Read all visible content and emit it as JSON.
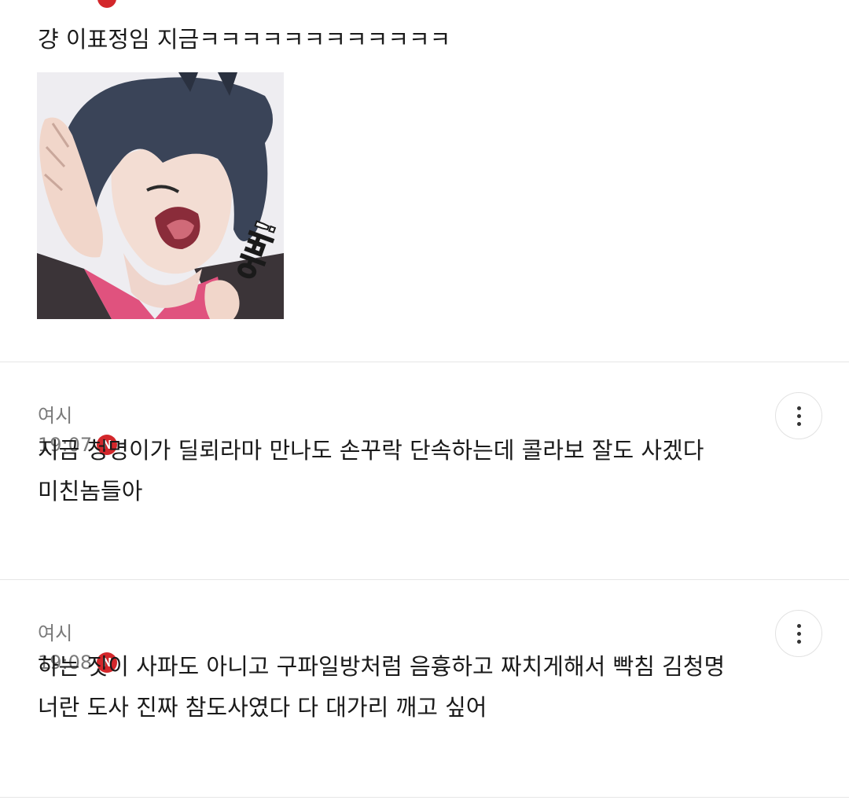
{
  "comments": [
    {
      "text": "걍 이표정임 지금ㅋㅋㅋㅋㅋㅋㅋㅋㅋㅋㅋㅋ",
      "sticker_text": "어버!"
    },
    {
      "author": "여시",
      "time": "19:07",
      "badge": "N",
      "lines": [
        "지금 청명이가 딜뢰라마 만나도 손꾸락 단속하는데 콜라보 잘도 사겠다",
        "미친놈들아"
      ]
    },
    {
      "author": "여시",
      "time": "19:08",
      "badge": "N",
      "lines": [
        "하는 짓이 사파도 아니고 구파일방처럼 음흉하고 짜치게해서 빡침 김청명",
        "너란 도사 진짜 참도사였다 다 대가리 깨고 싶어"
      ]
    }
  ],
  "icons": {
    "more": "more-vertical-icon",
    "new": "new-badge-icon"
  },
  "colors": {
    "badge": "#d3272b",
    "meta_text": "#7a7a7a",
    "divider": "#e6e6e6"
  }
}
